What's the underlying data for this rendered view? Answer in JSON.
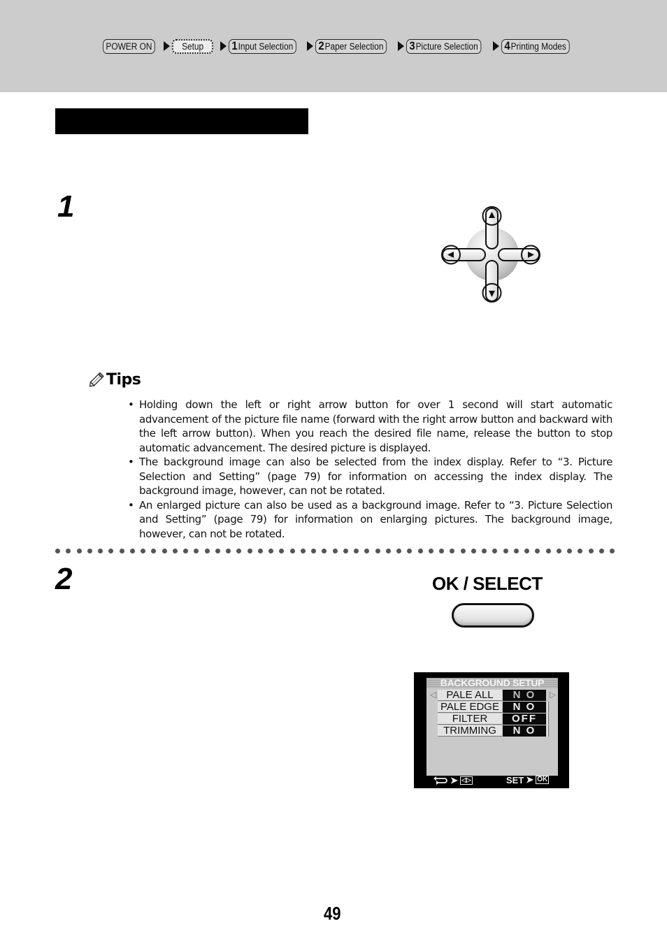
{
  "breadcrumb": {
    "items": [
      {
        "num": "",
        "label": "POWER ON",
        "style": "solid"
      },
      {
        "num": "",
        "label": "Setup",
        "style": "dashed"
      },
      {
        "num": "1",
        "label": "Input Selection",
        "style": "solid"
      },
      {
        "num": "2",
        "label": "Paper Selection",
        "style": "solid"
      },
      {
        "num": "3",
        "label": "Picture Selection",
        "style": "solid"
      },
      {
        "num": "4",
        "label": "Printing Modes",
        "style": "solid"
      }
    ]
  },
  "colors": {
    "header_band": "#cccccc",
    "title_bar": "#000000",
    "separator_dots": "#555555"
  },
  "steps": [
    {
      "number": "1"
    },
    {
      "number": "2"
    }
  ],
  "arrow_pad": {
    "icons": [
      "up-arrow-button",
      "down-arrow-button",
      "left-arrow-button",
      "right-arrow-button"
    ]
  },
  "tips": {
    "heading": "Tips",
    "icon": "pencil-icon",
    "items": [
      "Holding down the left or right arrow button for over 1 second will start automatic advancement of the picture file name (forward with the right arrow button and backward with the left arrow button). When you reach the desired file name, release the button to stop automatic advancement. The desired picture is displayed.",
      "The background image can also be selected from the index display. Refer to “3. Picture Selection and Setting” (page 79) for information on accessing the index display. The background image, however, can not be rotated.",
      "An enlarged picture can also be used as a background image. Refer to “3. Picture Selection  and Setting” (page 79) for information on enlarging pictures. The background image, however, can not be rotated."
    ]
  },
  "ok_select": {
    "label": "OK / SELECT"
  },
  "lcd": {
    "title": "BACKGROUND SETUP",
    "rows": [
      {
        "label": "PALE ALL",
        "value": "N O"
      },
      {
        "label": "PALE EDGE",
        "value": "N O"
      },
      {
        "label": "FILTER",
        "value": "OFF"
      },
      {
        "label": "TRIMMING",
        "value": "N O"
      }
    ],
    "footer_left_box": "◁▷",
    "footer_right_label": "SET",
    "footer_ok": "OK"
  },
  "page_number": "49"
}
